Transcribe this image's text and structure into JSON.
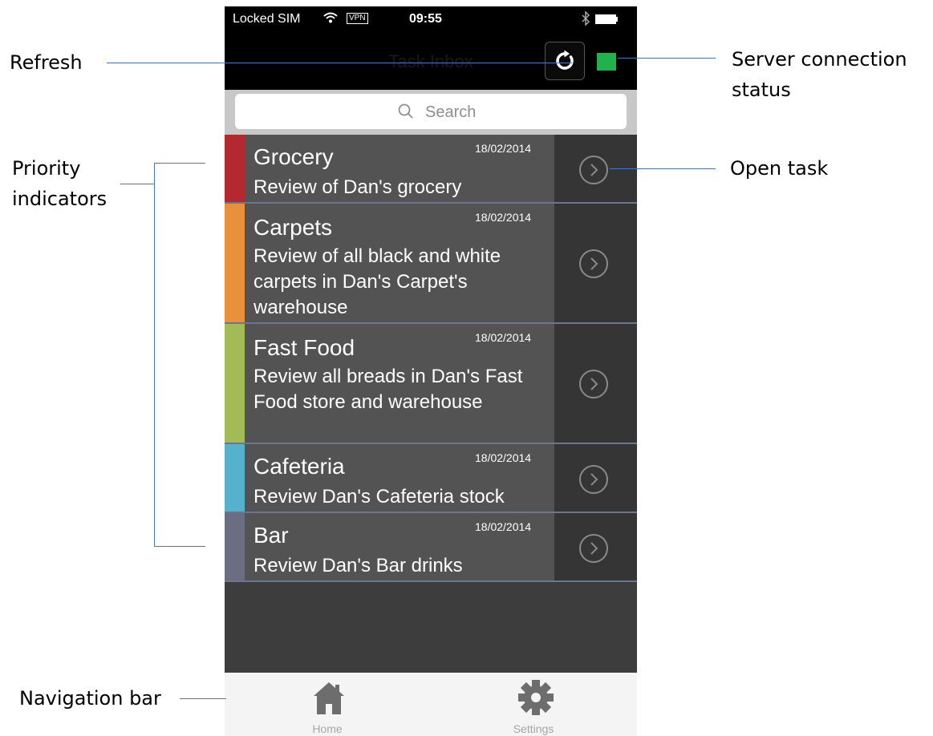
{
  "status_bar": {
    "carrier": "Locked SIM",
    "wifi_icon": "wifi-icon",
    "vpn": "VPN",
    "time": "09:55",
    "bluetooth_icon": "bluetooth-icon",
    "battery_icon": "battery-icon"
  },
  "nav_bar": {
    "title": "Task Inbox",
    "refresh_icon": "refresh-icon",
    "connection_status_color": "#22b14c"
  },
  "search": {
    "placeholder": "Search",
    "icon": "search-icon"
  },
  "tasks": [
    {
      "title": "Grocery",
      "date": "18/02/2014",
      "description": "Review of Dan's grocery",
      "priority_color": "#b3292f"
    },
    {
      "title": "Carpets",
      "date": "18/02/2014",
      "description": "Review of all black and white carpets in Dan's Carpet's warehouse",
      "priority_color": "#e8903a"
    },
    {
      "title": "Fast Food",
      "date": "18/02/2014",
      "description": "Review all breads in Dan's Fast Food store and warehouse",
      "priority_color": "#a3bb56"
    },
    {
      "title": "Cafeteria",
      "date": "18/02/2014",
      "description": "Review Dan's Cafeteria stock",
      "priority_color": "#56b1cc"
    },
    {
      "title": "Bar",
      "date": "18/02/2014",
      "description": "Review Dan's Bar drinks",
      "priority_color": "#6b6e80"
    }
  ],
  "tab_bar": {
    "items": [
      {
        "label": "Home",
        "icon": "home-icon"
      },
      {
        "label": "Settings",
        "icon": "gear-icon"
      }
    ]
  },
  "annotations": {
    "refresh": "Refresh",
    "server_connection_status_line1": "Server connection",
    "server_connection_status_line2": "status",
    "priority_indicators_line1": "Priority",
    "priority_indicators_line2": "indicators",
    "open_task": "Open task",
    "navigation_bar": "Navigation bar"
  },
  "colors": {
    "row_background": "#535353",
    "row_side_background": "#353535",
    "row_separator": "#6a7590",
    "list_background": "#3d3d3d",
    "callout_line": "#4a76b8"
  }
}
